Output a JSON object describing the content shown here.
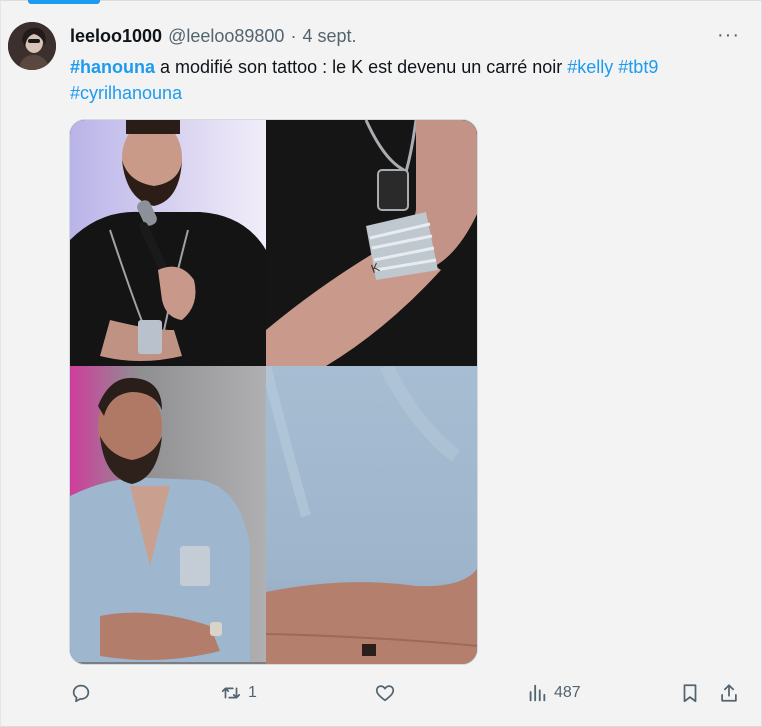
{
  "tweet": {
    "display_name": "leeloo1000",
    "handle": "@leeloo89800",
    "separator": "·",
    "date": "4 sept.",
    "more_label": "···",
    "text": {
      "tag1": "#hanouna",
      "body": " a modifié son tattoo : le K est devenu un carré noir ",
      "tag2": "#kelly",
      "space": " ",
      "tag3": "#tbt9",
      "tag4": "#cyrilhanouna"
    }
  },
  "actions": {
    "reply_icon": "reply-icon",
    "retweet_icon": "retweet-icon",
    "retweet_count": "1",
    "like_icon": "heart-icon",
    "views_icon": "views-icon",
    "views_count": "487",
    "bookmark_icon": "bookmark-icon",
    "share_icon": "share-icon"
  },
  "colors": {
    "link": "#1d9bf0",
    "muted": "#536471",
    "text": "#0f1419",
    "background": "#f3f3f3"
  }
}
